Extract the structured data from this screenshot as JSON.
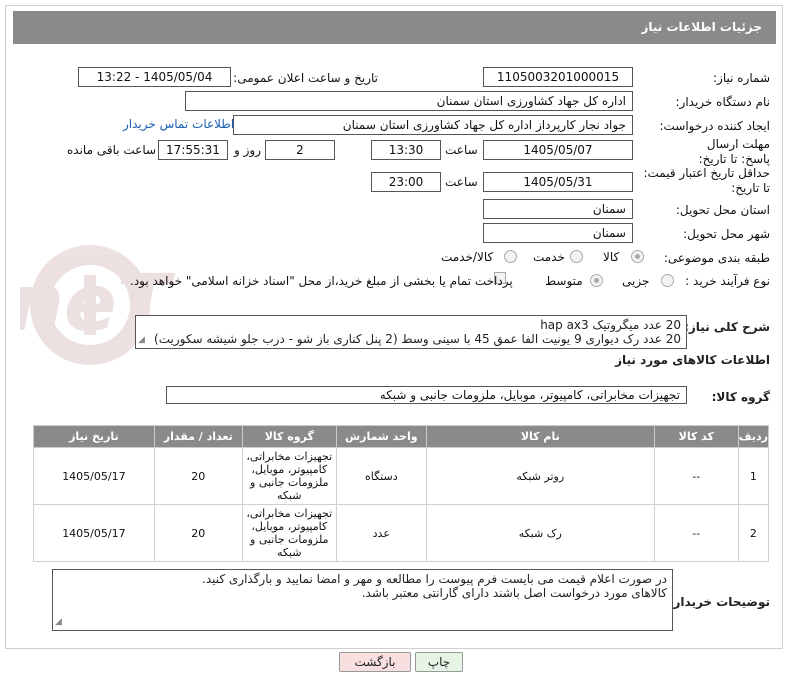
{
  "window_title": "جزئیات اطلاعات نیاز",
  "fields": {
    "need_number_label": "شماره نیاز:",
    "need_number": "1105003201000015",
    "announce_label": "تاریخ و ساعت اعلان عمومی:",
    "announce_value": "1405/05/04 - 13:22",
    "buyer_org_label": "نام دستگاه خریدار:",
    "buyer_org": "اداره کل جهاد کشاورزی استان سمنان",
    "creator_label": "ایجاد کننده درخواست:",
    "creator": "جواد نجار کارپرداز اداره کل جهاد کشاورزی استان سمنان",
    "contact_link": "اطلاعات تماس خریدار",
    "deadline_label": "مهلت ارسال پاسخ: تا تاریخ:",
    "deadline_date": "1405/05/07",
    "time_label": "ساعت",
    "deadline_time": "13:30",
    "days_count": "2",
    "days_label": "روز و",
    "remaining_time": "17:55:31",
    "remaining_label": "ساعت باقی مانده",
    "price_validity_label": "حداقل تاریخ اعتبار قیمت: تا تاریخ:",
    "price_validity_date": "1405/05/31",
    "price_validity_time": "23:00",
    "province_label": "استان محل تحویل:",
    "province": "سمنان",
    "city_label": "شهر محل تحویل:",
    "city": "سمنان",
    "category_label": "طبقه بندی موضوعی:",
    "category_options": [
      "کالا",
      "خدمت",
      "کالا/خدمت"
    ],
    "process_label": "نوع فرآیند خرید :",
    "process_options": [
      "جزیی",
      "متوسط"
    ],
    "payment_note": "پرداخت تمام یا بخشی از مبلغ خرید،از محل \"اسناد خزانه اسلامی\" خواهد بود.",
    "description_label": "شرح کلی نیاز:",
    "description_line1": "20 عدد میگروتیک hap ax3",
    "description_line2": "20 عدد رک دیواری 9 یونیت الفا عمق 45 با سینی وسط (2 پنل کناری باز شو - درب جلو شیشه سکوریت)"
  },
  "goods_section": {
    "title": "اطلاعات کالاهای مورد نیاز",
    "group_label": "گروه کالا:",
    "group_value": "تجهیزات مخابراتی، کامپیوتر، موبایل، ملزومات جانبی و شبکه"
  },
  "table": {
    "headers": [
      "ردیف",
      "کد کالا",
      "نام کالا",
      "واحد شمارش",
      "گروه کالا",
      "تعداد / مقدار",
      "تاریخ نیاز"
    ],
    "rows": [
      {
        "row": "1",
        "code": "--",
        "name": "روتر شبکه",
        "unit": "دستگاه",
        "group": "تجهیزات مخابراتی، کامپیوتر، موبایل، ملزومات جانبی و شبکه",
        "qty": "20",
        "date": "1405/05/17"
      },
      {
        "row": "2",
        "code": "--",
        "name": "رک شبکه",
        "unit": "عدد",
        "group": "تجهیزات مخابراتی، کامپیوتر، موبایل، ملزومات جانبی و شبکه",
        "qty": "20",
        "date": "1405/05/17"
      }
    ]
  },
  "buyer_notes": {
    "label": "توضیحات خریدار:",
    "line1": "در صورت اعلام قیمت می بایست فرم پیوست را مطالعه و مهر و امضا نمایید و بارگذاری کنید.",
    "line2": "کالاهای مورد درخواست اصل باشند دارای گارانتی معتبر باشد."
  },
  "buttons": {
    "print": "چاپ",
    "back": "بازگشت"
  },
  "colors": {
    "header_bg": "#8a8a8a",
    "link": "#1a5fb4",
    "back_btn_bg": "#f9e0e0",
    "print_btn_bg": "#e6f4e6"
  }
}
